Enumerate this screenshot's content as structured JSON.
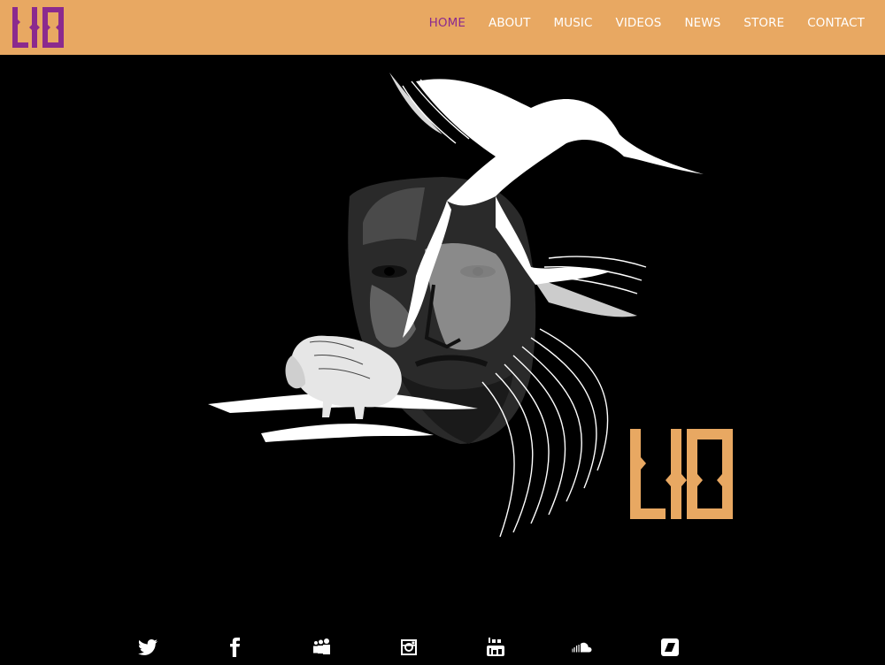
{
  "brand": {
    "logo_text": "LIO",
    "logo_color": "#8b2a8e",
    "hero_logo_color": "#e8a862"
  },
  "nav": {
    "items": [
      {
        "label": "HOME",
        "active": true
      },
      {
        "label": "ABOUT",
        "active": false
      },
      {
        "label": "MUSIC",
        "active": false
      },
      {
        "label": "VIDEOS",
        "active": false
      },
      {
        "label": "NEWS",
        "active": false
      },
      {
        "label": "STORE",
        "active": false
      },
      {
        "label": "CONTACT",
        "active": false
      }
    ]
  },
  "colors": {
    "header_bg": "#e8a862",
    "page_bg": "#000000",
    "nav_text": "#ffffff",
    "nav_active": "#8b2a8e"
  },
  "hero": {
    "artwork": "illustrated-portrait-with-bison-and-white-brushstrokes"
  },
  "social": {
    "icons": [
      "twitter-icon",
      "facebook-icon",
      "myspace-icon",
      "instagram-icon",
      "youtube-icon",
      "soundcloud-icon",
      "bandcamp-icon"
    ]
  }
}
